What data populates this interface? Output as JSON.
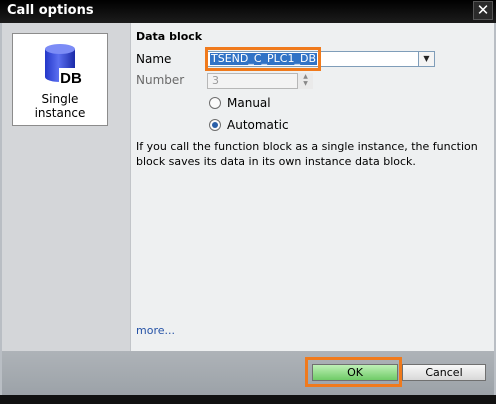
{
  "window": {
    "title": "Call options",
    "close_glyph": "✕"
  },
  "left_pane": {
    "card_icon": "db-cylinder-icon",
    "icon_text": "DB",
    "card_label_line1": "Single",
    "card_label_line2": "instance"
  },
  "data_block": {
    "section_title": "Data block",
    "name_label": "Name",
    "name_value": "TSEND_C_PLC1_DB",
    "number_label": "Number",
    "number_value": "3",
    "radio_manual": "Manual",
    "radio_automatic": "Automatic",
    "selected_radio": "Automatic",
    "description": "If you call the function block as a single instance, the function block saves its data in its own instance data block.",
    "more_link": "more..."
  },
  "buttons": {
    "ok_label": "OK",
    "cancel_label": "Cancel"
  },
  "colors": {
    "highlight": "#f07a1c",
    "ok_button": "#6fcb67",
    "selection": "#3173c6",
    "db_icon": "#3b53e0",
    "link": "#2552a6"
  }
}
